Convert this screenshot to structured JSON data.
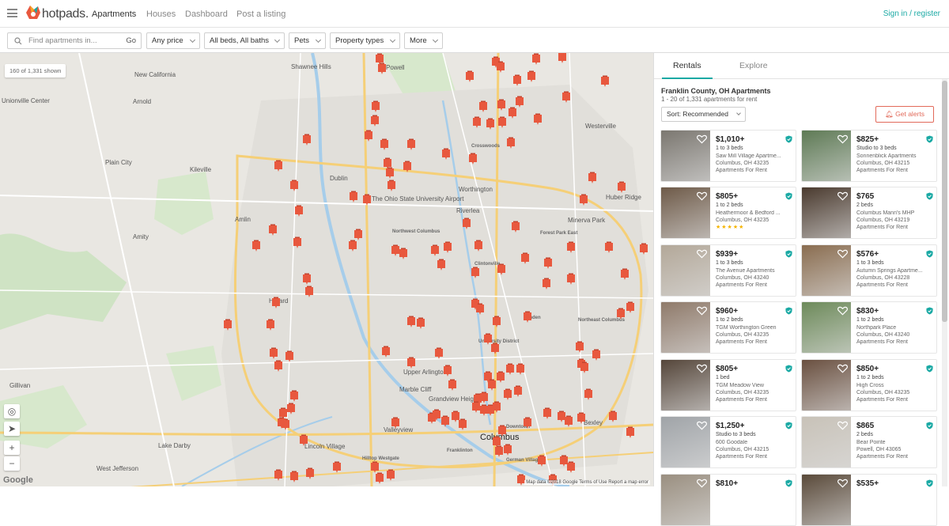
{
  "header": {
    "brand": "hotpads.",
    "nav": [
      "Apartments",
      "Houses",
      "Dashboard",
      "Post a listing"
    ],
    "signin": "Sign in / register"
  },
  "filters": {
    "search_placeholder": "Find apartments in...",
    "go": "Go",
    "price": "Any price",
    "beds": "All beds, All baths",
    "pets": "Pets",
    "property_types": "Property types",
    "more": "More"
  },
  "map": {
    "count_badge": "160 of 1,331 shown",
    "labels": [
      "Shawnee Hills",
      "Powell",
      "New California",
      "Unionville Center",
      "Arnold",
      "Plain City",
      "Kileville",
      "Dublin",
      "The Ohio State University Airport",
      "Worthington",
      "Westerville",
      "Huber Ridge",
      "Amlin",
      "Riverlea",
      "Minerva Park",
      "Amity",
      "Hilliard",
      "Upper Arlington",
      "Marble Cliff",
      "Grandview Heights",
      "Valleyview",
      "Columbus",
      "Bexley",
      "Lake Darby",
      "Lincoln Village",
      "Gillivan",
      "West Jefferson",
      "Franklinton",
      "Crosswoods",
      "Northwest Columbus",
      "Forest Park East",
      "Clintonville",
      "Northeast Columbus",
      "Linden",
      "University District",
      "Downtown",
      "Hilltop Westgate",
      "German Village"
    ],
    "attribution": "Map data ©2018 Google   Terms of Use   Report a map error",
    "google": "Google",
    "zoom_in": "+",
    "zoom_out": "−"
  },
  "panel": {
    "tabs": [
      "Rentals",
      "Explore"
    ],
    "title": "Franklin County, OH Apartments",
    "subtitle": "1 - 20 of 1,331 apartments for rent",
    "sort": "Sort: Recommended",
    "alerts": "Get alerts",
    "listings": [
      {
        "price": "$1,010+",
        "beds": "1 to 3 beds",
        "name": "Saw Mill Village Apartme...",
        "addr": "Columbus, OH 43235",
        "type": "Apartments For Rent"
      },
      {
        "price": "$825+",
        "beds": "Studio to 3 beds",
        "name": "Sonnenblick Apartments",
        "addr": "Columbus, OH 43215",
        "type": "Apartments For Rent"
      },
      {
        "price": "$805+",
        "beds": "1 to 2 beds",
        "name": "Heathermoor & Bedford ...",
        "addr": "Columbus, OH 43235",
        "type": "",
        "stars": "★★★★★"
      },
      {
        "price": "$765",
        "beds": "2 beds",
        "name": "Columbus Mann's MHP",
        "addr": "Columbus, OH 43219",
        "type": "Apartments For Rent"
      },
      {
        "price": "$939+",
        "beds": "1 to 3 beds",
        "name": "The Avenue Apartments",
        "addr": "Columbus, OH 43240",
        "type": "Apartments For Rent"
      },
      {
        "price": "$576+",
        "beds": "1 to 3 beds",
        "name": "Autumn Springs Apartme...",
        "addr": "Columbus, OH 43228",
        "type": "Apartments For Rent"
      },
      {
        "price": "$960+",
        "beds": "1 to 2 beds",
        "name": "TGM Worthington Green",
        "addr": "Columbus, OH 43235",
        "type": "Apartments For Rent"
      },
      {
        "price": "$830+",
        "beds": "1 to 2 beds",
        "name": "Northpark Place",
        "addr": "Columbus, OH 43240",
        "type": "Apartments For Rent"
      },
      {
        "price": "$805+",
        "beds": "1 bed",
        "name": "TGM Meadow View",
        "addr": "Columbus, OH 43235",
        "type": "Apartments For Rent"
      },
      {
        "price": "$850+",
        "beds": "1 to 2 beds",
        "name": "High Cross",
        "addr": "Columbus, OH 43235",
        "type": "Apartments For Rent"
      },
      {
        "price": "$1,250+",
        "beds": "Studio to 3 beds",
        "name": "600 Goodale",
        "addr": "Columbus, OH 43215",
        "type": "Apartments For Rent"
      },
      {
        "price": "$865",
        "beds": "2 beds",
        "name": "Bear Pointe",
        "addr": "Powell, OH 43065",
        "type": "Apartments For Rent"
      },
      {
        "price": "$810+",
        "beds": "",
        "name": "",
        "addr": "",
        "type": ""
      },
      {
        "price": "$535+",
        "beds": "",
        "name": "",
        "addr": "",
        "type": ""
      }
    ]
  },
  "colors": {
    "accent": "#1aa9a4",
    "marker": "#e8583e",
    "alert": "#e26a5a"
  }
}
